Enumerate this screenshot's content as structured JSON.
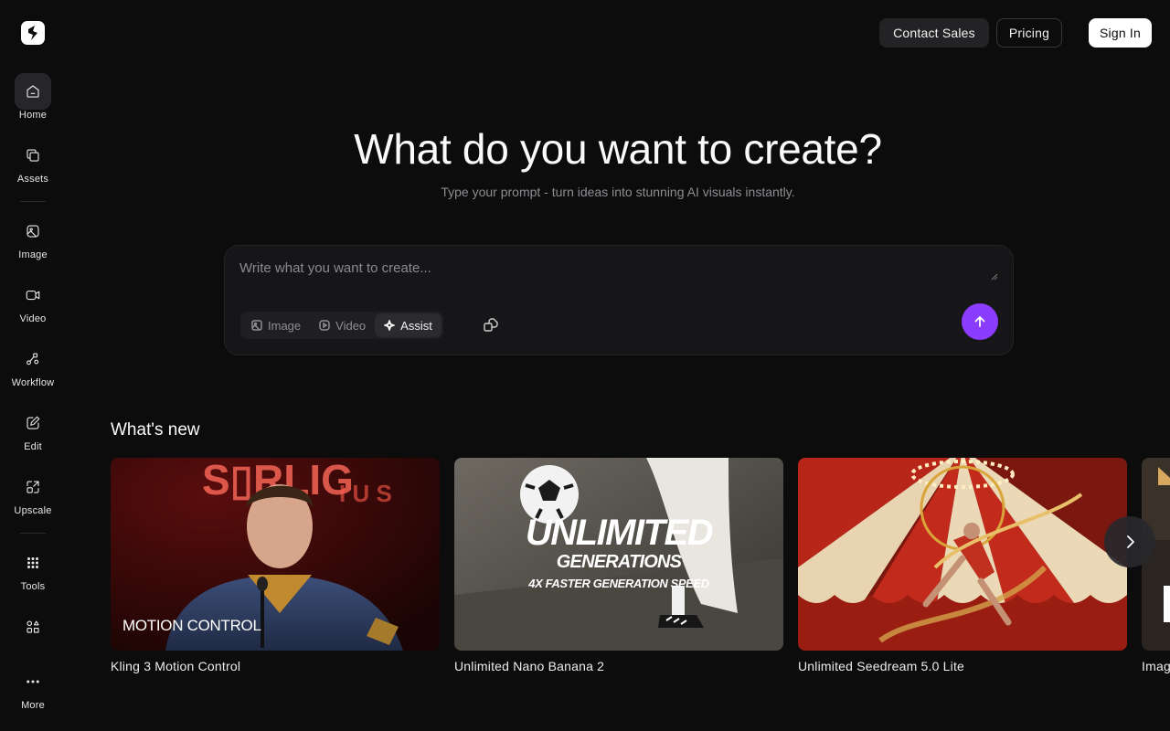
{
  "sidebar": {
    "items": [
      {
        "label": "Home",
        "icon": "home-icon"
      },
      {
        "label": "Assets",
        "icon": "assets-icon"
      },
      {
        "label": "Image",
        "icon": "image-icon"
      },
      {
        "label": "Video",
        "icon": "video-icon"
      },
      {
        "label": "Workflow",
        "icon": "workflow-icon"
      },
      {
        "label": "Edit",
        "icon": "edit-icon"
      },
      {
        "label": "Upscale",
        "icon": "upscale-icon"
      },
      {
        "label": "Tools",
        "icon": "grid-icon"
      },
      {
        "label": "",
        "icon": "apps-icon"
      },
      {
        "label": "More",
        "icon": "more-icon"
      }
    ]
  },
  "header": {
    "contact_label": "Contact Sales",
    "pricing_label": "Pricing",
    "signin_label": "Sign In"
  },
  "hero": {
    "title": "What do you want to create?",
    "subtitle": "Type your prompt - turn ideas into stunning AI visuals instantly."
  },
  "prompt": {
    "placeholder": "Write what you want to create...",
    "modes": [
      {
        "label": "Image",
        "icon": "image-icon"
      },
      {
        "label": "Video",
        "icon": "video-icon"
      },
      {
        "label": "Assist",
        "icon": "sparkle-icon"
      }
    ],
    "accent": "#8b3dff"
  },
  "whats_new": {
    "title": "What's new",
    "cards": [
      {
        "caption": "Kling 3 Motion Control",
        "overlay": "MOTION CONTROL"
      },
      {
        "caption": "Unlimited Nano Banana 2",
        "overlay_lines": [
          "UNLIMITED",
          "GENERATIONS",
          "4X FASTER GENERATION SPEED"
        ]
      },
      {
        "caption": "Unlimited Seedream 5.0 Lite"
      },
      {
        "caption": "Imag"
      }
    ]
  }
}
